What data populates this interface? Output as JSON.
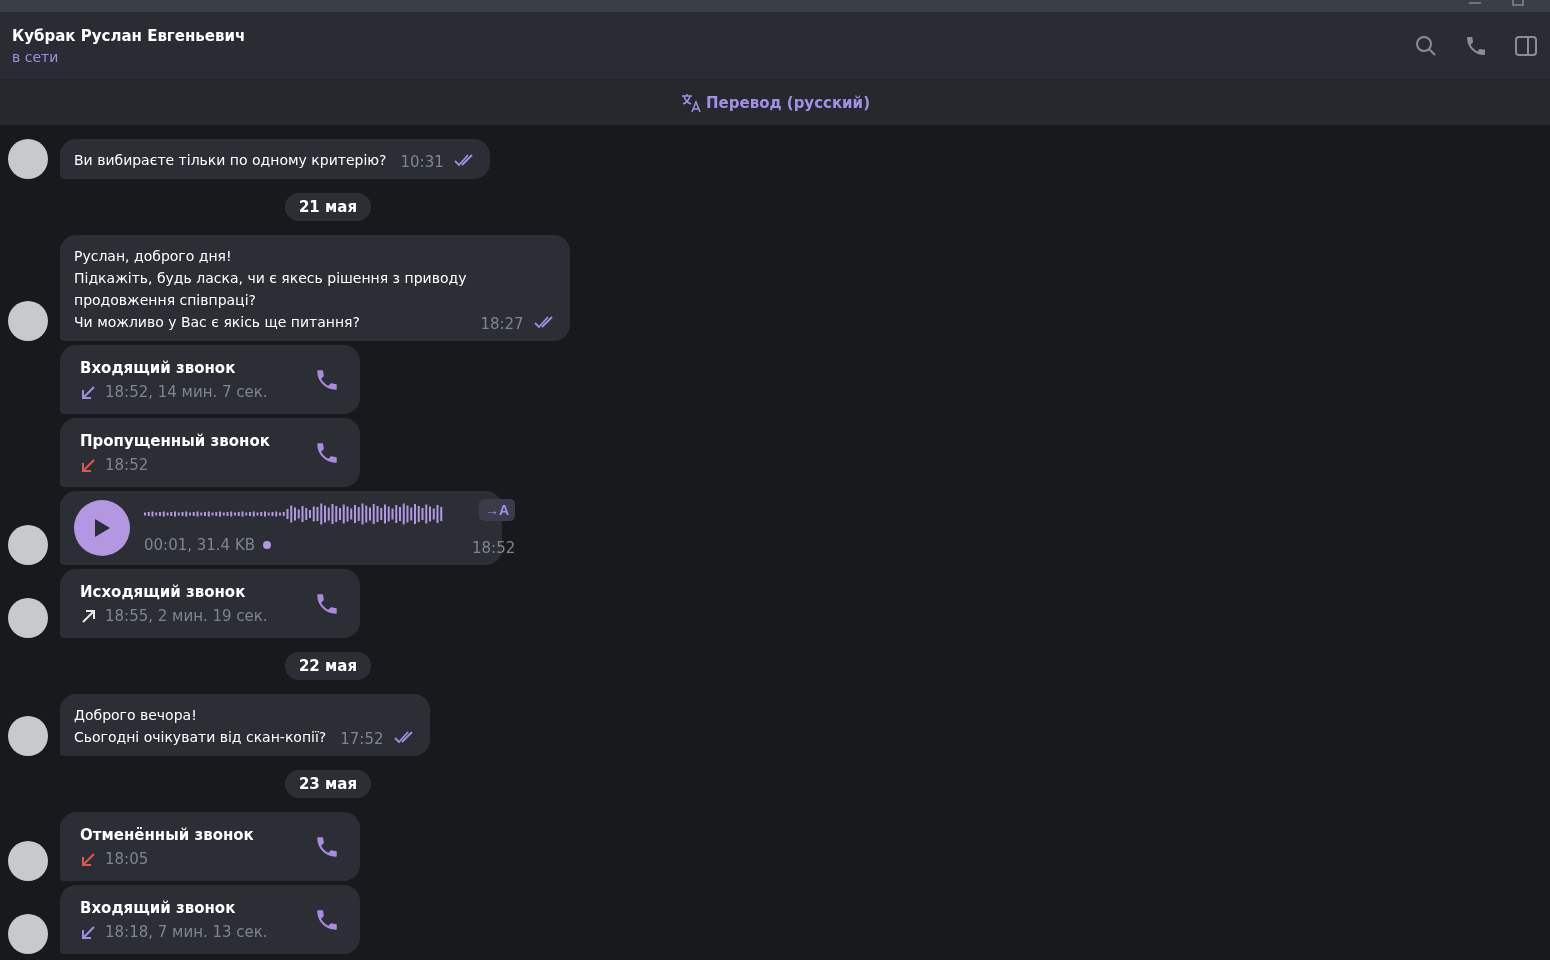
{
  "header": {
    "name": "Кубрак Руслан Евгеньевич",
    "status": "в сети"
  },
  "translate_bar": {
    "label": "Перевод (русский)"
  },
  "messages": [
    {
      "kind": "text",
      "avatar": true,
      "lines": [
        "Ви вибираєте тільки по одному критерію?"
      ],
      "time": "10:31",
      "read": true
    },
    {
      "kind": "date",
      "label": "21 мая"
    },
    {
      "kind": "text",
      "avatar": true,
      "lines": [
        "Руслан, доброго дня!",
        "Підкажіть, будь ласка, чи є якесь рішення з приводу",
        "продовження співпраці?",
        "Чи можливо у Вас є якісь ще питання?"
      ],
      "time": "18:27",
      "read": true
    },
    {
      "kind": "call",
      "avatar": false,
      "title": "Входящий звонок",
      "outgoing": false,
      "missed": false,
      "detail": "18:52, 14 мин. 7 сек."
    },
    {
      "kind": "call",
      "avatar": false,
      "title": "Пропущенный звонок",
      "outgoing": false,
      "missed": true,
      "detail": "18:52"
    },
    {
      "kind": "voice",
      "avatar": true,
      "meta": "00:01, 31.4 KB",
      "unlistened": true,
      "transcribe": "→A",
      "time": "18:52"
    },
    {
      "kind": "call",
      "avatar": true,
      "title": "Исходящий звонок",
      "outgoing": true,
      "missed": false,
      "detail": "18:55, 2 мин. 19 сек."
    },
    {
      "kind": "date",
      "label": "22 мая"
    },
    {
      "kind": "text",
      "avatar": true,
      "lines": [
        "Доброго вечора!",
        "Сьогодні очікувати від скан-копії?"
      ],
      "time": "17:52",
      "read": true
    },
    {
      "kind": "date",
      "label": "23 мая"
    },
    {
      "kind": "call",
      "avatar": true,
      "title": "Отменённый звонок",
      "outgoing": false,
      "missed": true,
      "detail": "18:05"
    },
    {
      "kind": "call",
      "avatar": true,
      "title": "Входящий звонок",
      "outgoing": false,
      "missed": false,
      "detail": "18:18, 7 мин. 13 сек."
    }
  ]
}
